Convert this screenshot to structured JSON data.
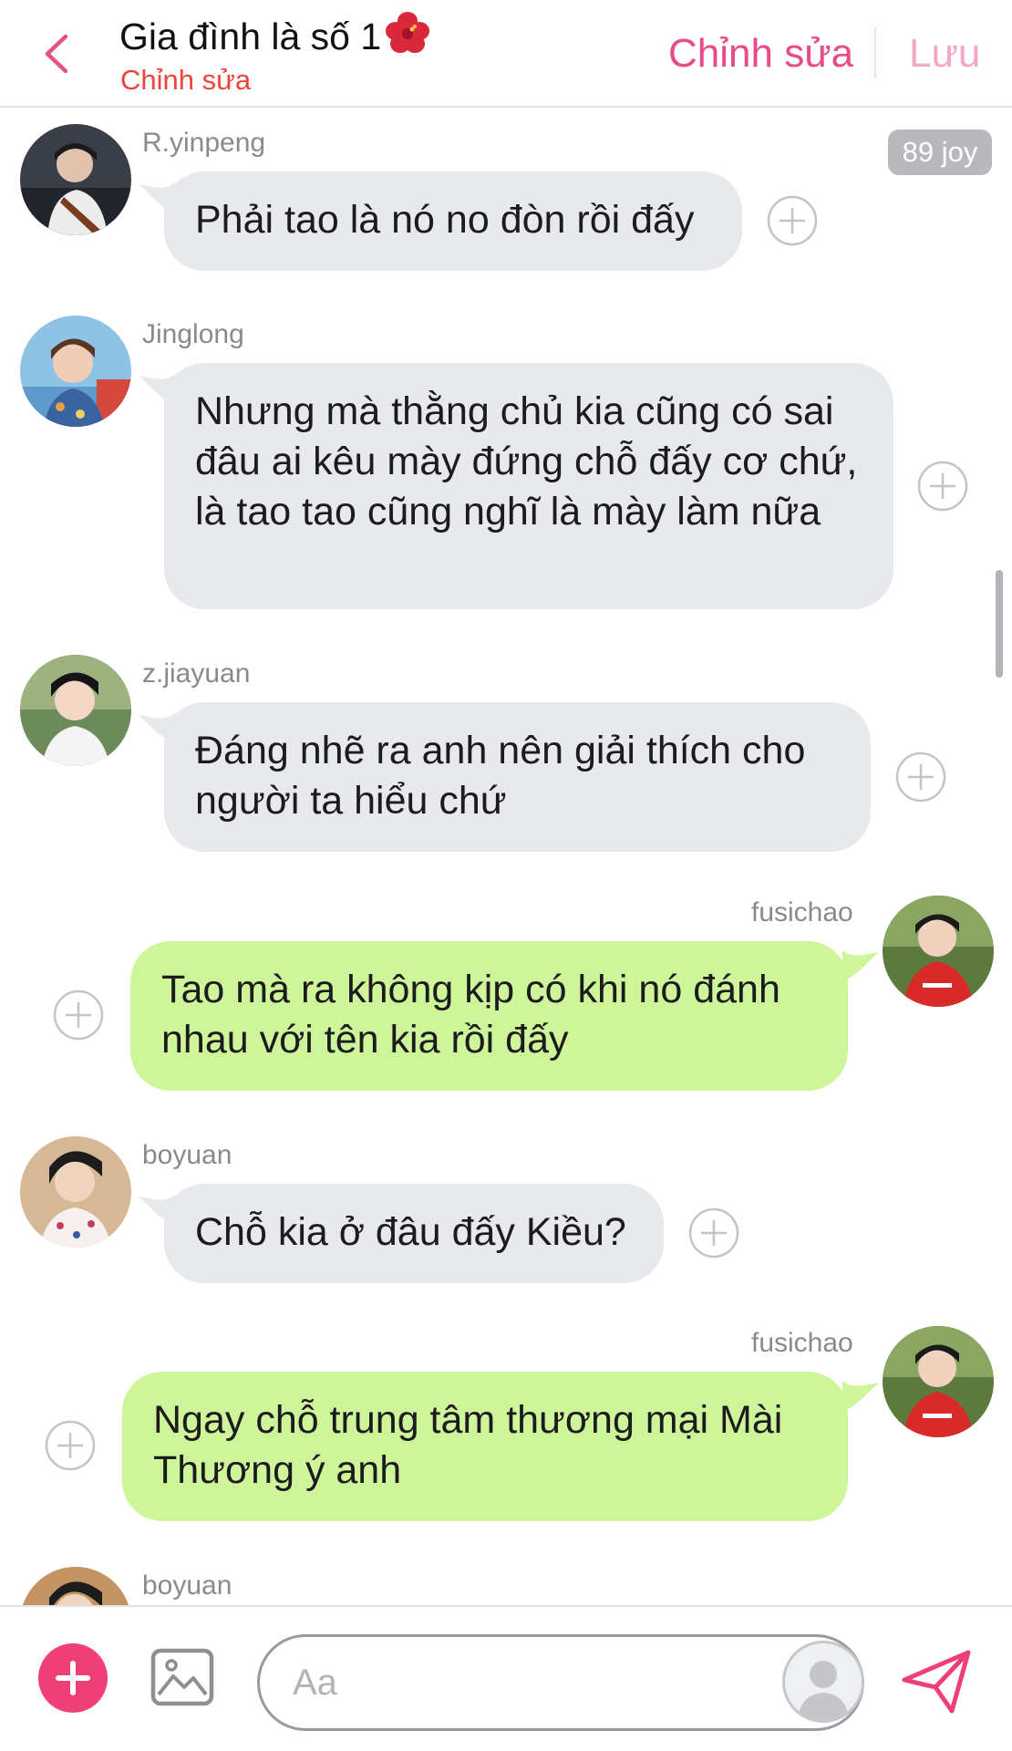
{
  "header": {
    "title": "Gia đình là số 1",
    "subtitle": "Chỉnh sửa",
    "edit_label": "Chỉnh sửa",
    "save_label": "Lưu"
  },
  "badge": "89 joy",
  "messages": [
    {
      "sender": "R.yinpeng",
      "text": "Phải tao là nó no đòn rồi đấy"
    },
    {
      "sender": "Jinglong",
      "text": "Nhưng mà thằng chủ kia cũng có sai đâu ai kêu mày đứng chỗ đấy cơ chứ, là tao tao cũng nghĩ là mày làm nữa"
    },
    {
      "sender": "z.jiayuan",
      "text": "Đáng nhẽ ra anh nên giải thích cho người ta hiểu chứ"
    },
    {
      "sender": "fusichao",
      "text": "Tao mà ra không kịp có khi nó đánh nhau với tên kia rồi đấy"
    },
    {
      "sender": "boyuan",
      "text": "Chỗ kia ở đâu đấy Kiều?"
    },
    {
      "sender": "fusichao",
      "text": "Ngay chỗ trung tâm thương mại Mài Thương ý anh"
    },
    {
      "sender": "boyuan",
      "text": ""
    }
  ],
  "composer": {
    "placeholder": "Aa"
  },
  "colors": {
    "accent": "#ef3f77",
    "edit_link": "#e84a8a",
    "subtitle": "#f0433a",
    "bubble_incoming": "#e8e9ec",
    "bubble_outgoing": "#cef59a"
  },
  "icons": [
    "chevron-left-icon",
    "hibiscus-icon",
    "plus-circle-icon",
    "add-icon",
    "image-icon",
    "person-icon",
    "send-icon"
  ]
}
